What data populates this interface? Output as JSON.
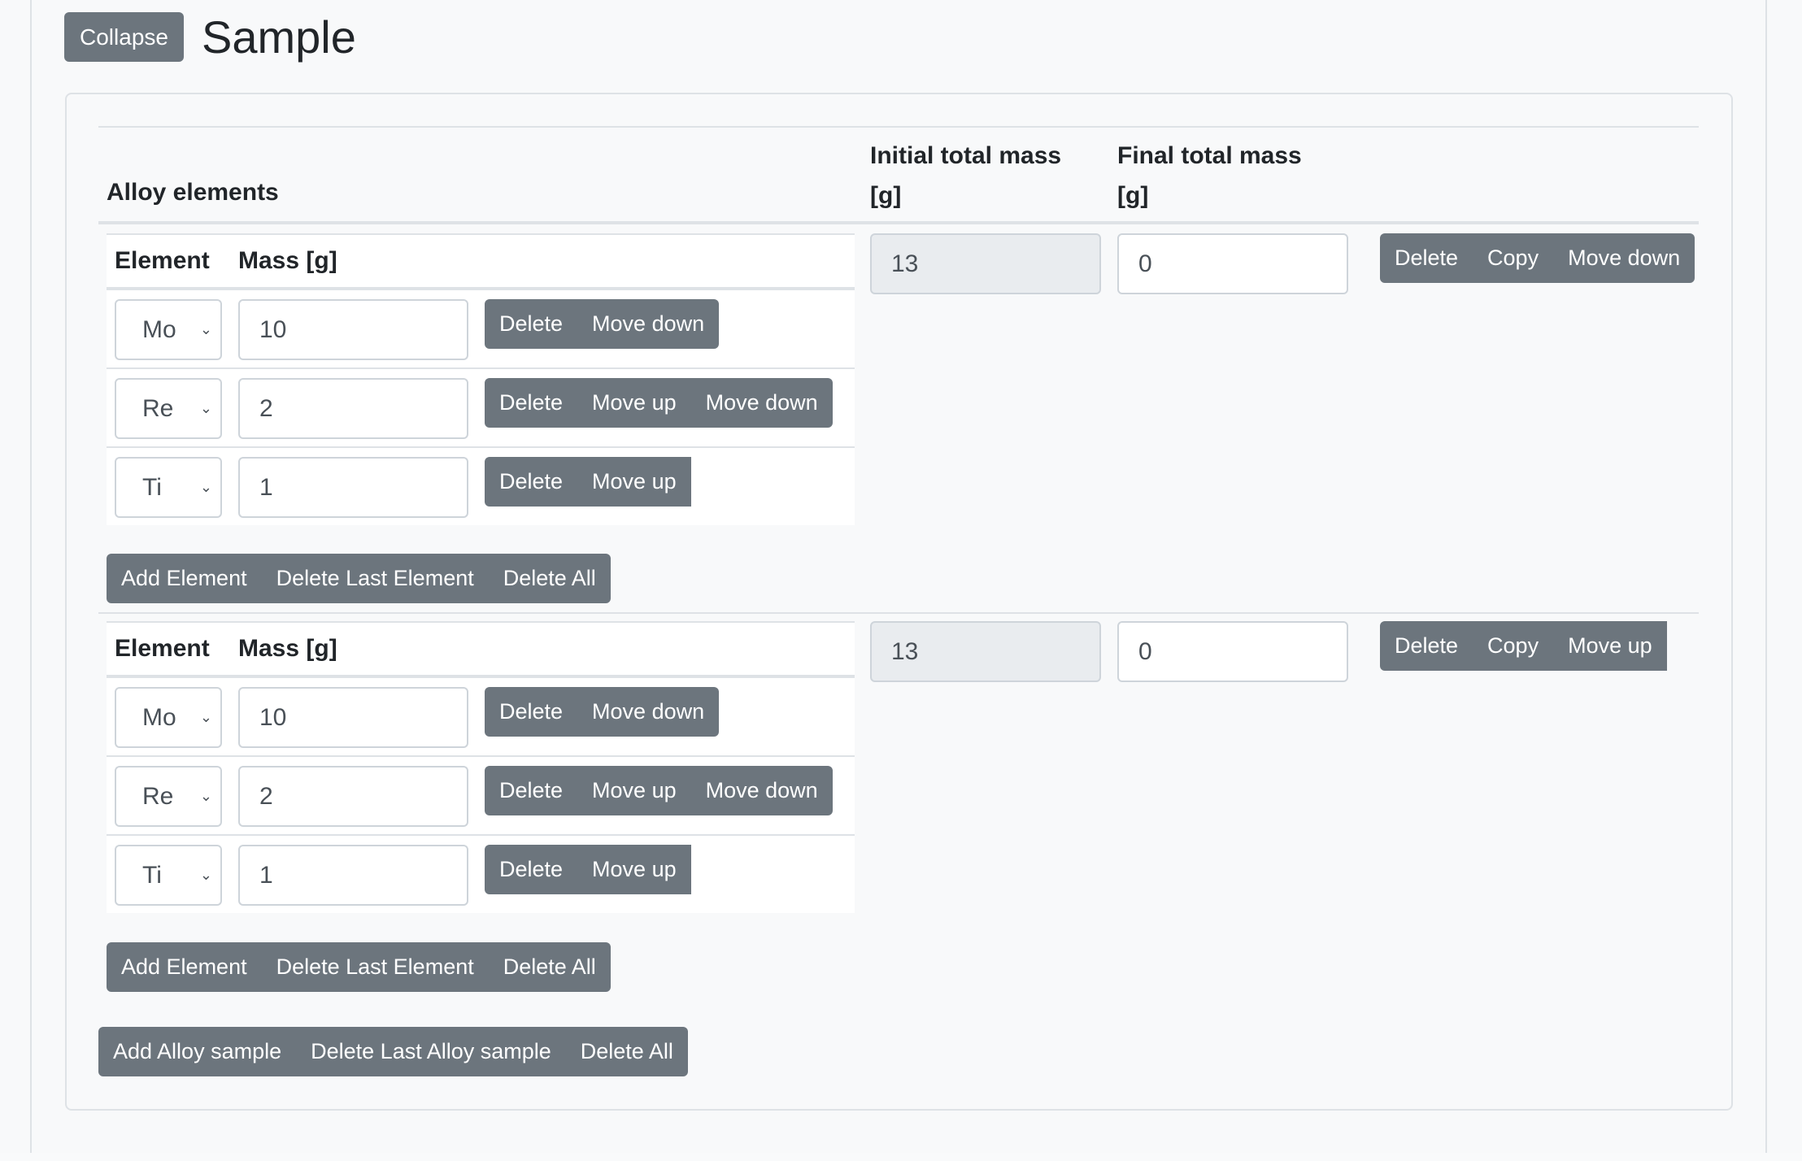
{
  "header": {
    "collapse_label": "Collapse",
    "title": "Sample"
  },
  "columns": {
    "alloy_elements": "Alloy elements",
    "initial_total_mass_line1": "Initial total mass",
    "initial_total_mass_line2": "[g]",
    "final_total_mass_line1": "Final total mass",
    "final_total_mass_line2": "[g]"
  },
  "element_table": {
    "col_element": "Element",
    "col_mass": "Mass [g]"
  },
  "samples": [
    {
      "elements": [
        {
          "element": "Mo",
          "mass": "10",
          "actions": [
            "Delete",
            "Move down"
          ]
        },
        {
          "element": "Re",
          "mass": "2",
          "actions": [
            "Delete",
            "Move up",
            "Move down"
          ]
        },
        {
          "element": "Ti",
          "mass": "1",
          "actions": [
            "Delete",
            "Move up"
          ]
        }
      ],
      "element_actions": [
        "Add Element",
        "Delete Last Element",
        "Delete All"
      ],
      "initial_total_mass": "13",
      "final_total_mass": "0",
      "sample_actions": [
        "Delete",
        "Copy",
        "Move down"
      ]
    },
    {
      "elements": [
        {
          "element": "Mo",
          "mass": "10",
          "actions": [
            "Delete",
            "Move down"
          ]
        },
        {
          "element": "Re",
          "mass": "2",
          "actions": [
            "Delete",
            "Move up",
            "Move down"
          ]
        },
        {
          "element": "Ti",
          "mass": "1",
          "actions": [
            "Delete",
            "Move up"
          ]
        }
      ],
      "element_actions": [
        "Add Element",
        "Delete Last Element",
        "Delete All"
      ],
      "initial_total_mass": "13",
      "final_total_mass": "0",
      "sample_actions": [
        "Delete",
        "Copy",
        "Move up"
      ]
    }
  ],
  "alloy_actions": [
    "Add Alloy sample",
    "Delete Last Alloy sample",
    "Delete All"
  ],
  "icons": {
    "select_chevron": "chevron-down-icon"
  },
  "colors": {
    "button_bg": "#6c757d",
    "page_bg": "#f8f9fa",
    "border": "#dee2e6",
    "readonly_bg": "#e9ecef"
  }
}
